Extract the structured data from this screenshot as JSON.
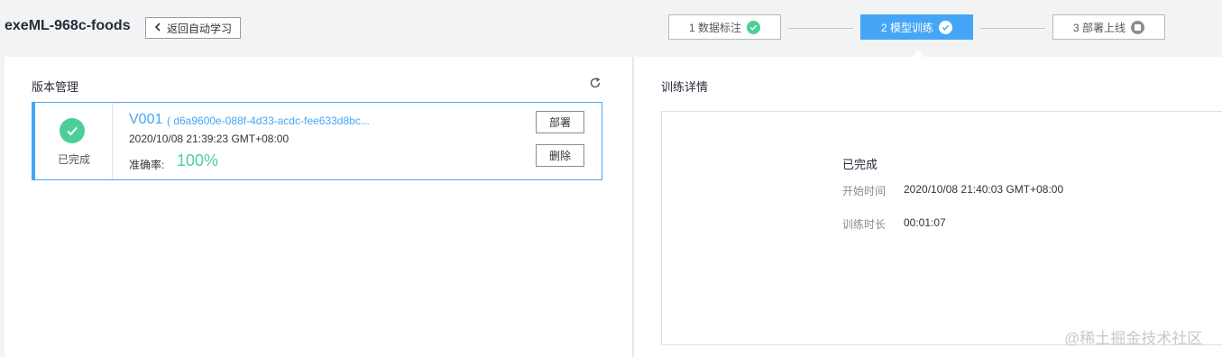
{
  "header": {
    "project_title": "exeML-968c-foods",
    "back_button": "返回自动学习",
    "steps": [
      {
        "label": "1 数据标注",
        "state": "done"
      },
      {
        "label": "2 模型训练",
        "state": "active"
      },
      {
        "label": "3 部署上线",
        "state": "pending"
      }
    ]
  },
  "version_panel": {
    "title": "版本管理",
    "card": {
      "status": "已完成",
      "version": "V001",
      "id": "( d6a9600e-088f-4d33-acdc-fee633d8bc...",
      "created_time": "2020/10/08 21:39:23 GMT+08:00",
      "accuracy_label": "准确率:",
      "accuracy_value": "100%",
      "deploy_button": "部署",
      "delete_button": "删除"
    }
  },
  "detail_panel": {
    "title": "训练详情",
    "status": "已完成",
    "start_time_label": "开始时间",
    "start_time_value": "2020/10/08 21:40:03 GMT+08:00",
    "duration_label": "训练时长",
    "duration_value": "00:01:07"
  },
  "watermark": "@稀土掘金技术社区",
  "colors": {
    "accent": "#45a6f7",
    "success": "#4ccf97"
  }
}
